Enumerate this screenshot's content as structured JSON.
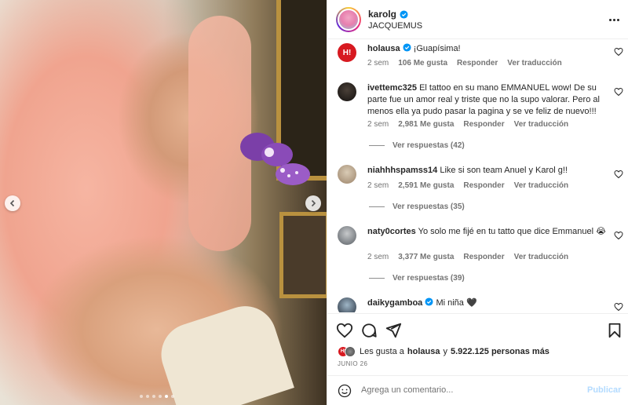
{
  "post": {
    "username": "karolg",
    "subtitle": "JACQUEMUS",
    "verified": true
  },
  "carousel": {
    "dots": 6,
    "active_dot": 4
  },
  "comments": [
    {
      "user": "holausa",
      "verified": true,
      "text": "¡Guapísima!",
      "time": "2 sem",
      "likes": "106 Me gusta",
      "reply": "Responder",
      "translate": "Ver traducción"
    },
    {
      "user": "ivettemc325",
      "verified": false,
      "text": "El tattoo en su mano EMMANUEL wow! De su parte fue un amor real y triste que no la supo valorar. Pero al menos ella ya pudo pasar la pagina y se ve feliz de nuevo!!!",
      "time": "2 sem",
      "likes": "2,981 Me gusta",
      "reply": "Responder",
      "translate": "Ver traducción",
      "replies": "Ver respuestas (42)"
    },
    {
      "user": "niahhhspamss14",
      "verified": false,
      "text": "Like si son team Anuel y Karol g!!",
      "time": "2 sem",
      "likes": "2,591 Me gusta",
      "reply": "Responder",
      "translate": "Ver traducción",
      "replies": "Ver respuestas (35)"
    },
    {
      "user": "naty0cortes",
      "verified": false,
      "text": "Yo solo me fijé en tu tatto que dice Emmanuel 😭",
      "time": "2 sem",
      "likes": "3,377 Me gusta",
      "reply": "Responder",
      "translate": "Ver traducción",
      "replies": "Ver respuestas (39)"
    },
    {
      "user": "daikygamboa",
      "verified": true,
      "text": "Mi niña 🖤"
    }
  ],
  "likes_line": {
    "prefix": "Les gusta a",
    "first": "holausa",
    "joiner": "y",
    "count": "5.922.125 personas más"
  },
  "date": "JUNIO 26",
  "composer": {
    "placeholder": "Agrega un comentario...",
    "post_label": "Publicar"
  },
  "colors": {
    "verified": "#0095f6",
    "meta": "#737373",
    "post_disabled": "#b3dbff",
    "holausa_brand": "#d71920"
  },
  "icons": [
    "chevron-left-icon",
    "chevron-right-icon",
    "more-icon",
    "heart-icon",
    "comment-icon",
    "share-icon",
    "bookmark-icon",
    "emoji-icon",
    "verified-icon"
  ]
}
